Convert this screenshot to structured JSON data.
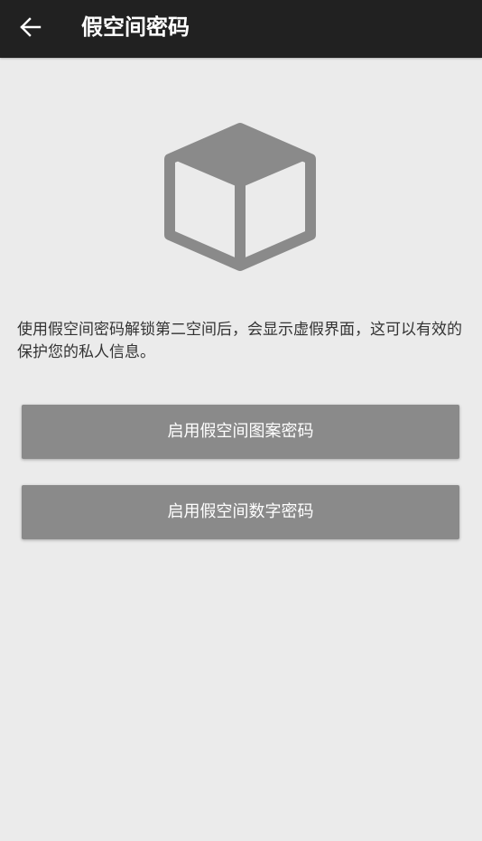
{
  "app_bar": {
    "title": "假空间密码",
    "back_icon": "arrow-left-icon",
    "background_color": "#212121",
    "text_color": "#ffffff"
  },
  "illustration": {
    "icon": "cube-icon",
    "color": "#8a8a8a"
  },
  "description": "使用假空间密码解锁第二空间后，会显示虚假界面，这可以有效的保护您的私人信息。",
  "buttons": {
    "enable_pattern_label": "启用假空间图案密码",
    "enable_number_label": "启用假空间数字密码",
    "background_color": "#8a8a8a"
  },
  "page": {
    "background_color": "#ebebeb"
  }
}
